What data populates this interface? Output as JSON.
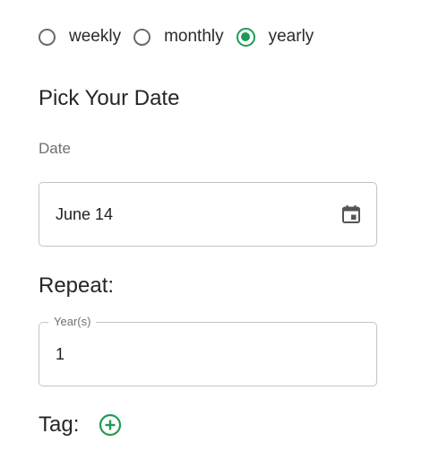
{
  "frequency": {
    "options": [
      {
        "label": "weekly",
        "checked": false
      },
      {
        "label": "monthly",
        "checked": false
      },
      {
        "label": "yearly",
        "checked": true
      }
    ]
  },
  "date_section": {
    "title": "Pick Your Date",
    "caption": "Date",
    "value": "June 14",
    "icon": "calendar-icon"
  },
  "repeat": {
    "title": "Repeat:",
    "legend": "Year(s)",
    "value": "1"
  },
  "tag": {
    "label": "Tag:",
    "add_icon": "add-circle-icon"
  },
  "colors": {
    "accent": "#1f9a55",
    "border": "#c4c4c4",
    "muted_text": "#6f6f6f",
    "text": "#262626"
  }
}
